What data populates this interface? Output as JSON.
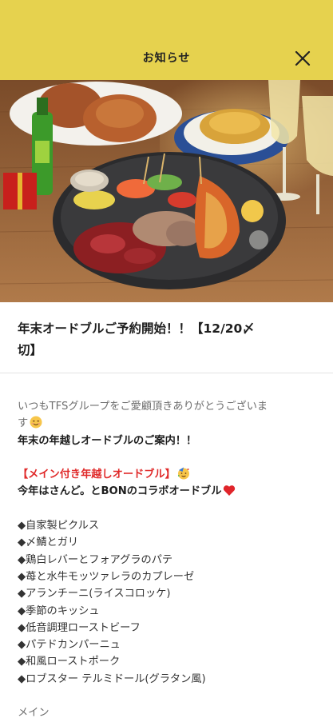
{
  "header": {
    "title": "お知らせ",
    "close_icon": "close-icon"
  },
  "colors": {
    "header_bg": "#e6d24e",
    "highlight_red": "#e02a2a"
  },
  "hero_image": {
    "icon": "party-platter-photo"
  },
  "article": {
    "title_line1": "年末オードブルご予約開始！！【12/20〆",
    "title_line2": "切】"
  },
  "body": {
    "greeting_line1": "いつもTFSグループをご愛顧頂きありがとうございま",
    "greeting_line2": "す",
    "intro": "年末の年越しオードブルのご案内！！",
    "highlight": "【メイン付き年越しオードブル】",
    "collab": "今年はさんど。とBONのコラボオードブル",
    "items": [
      "◆自家製ピクルス",
      "◆〆鯖とガリ",
      "◆鶏白レバーとフォアグラのパテ",
      "◆苺と水牛モッツァレラのカプレーゼ",
      "◆アランチーニ(ライスコロッケ)",
      "◆季節のキッシュ",
      "◆低音調理ローストビーフ",
      "◆パテドカンパーニュ",
      "◆和風ローストポーク",
      "◆ロブスター テルミドール(グラタン風)"
    ],
    "main_label": "メイン"
  }
}
